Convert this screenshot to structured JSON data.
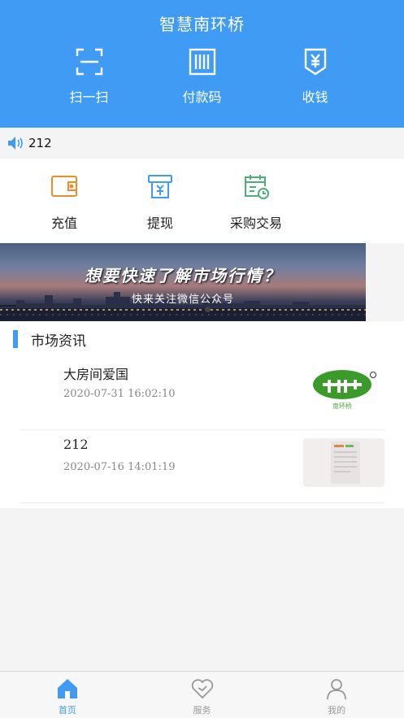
{
  "header": {
    "title": "智慧南环桥",
    "actions": [
      {
        "label": "扫一扫",
        "icon": "scan-icon"
      },
      {
        "label": "付款码",
        "icon": "barcode-icon"
      },
      {
        "label": "收钱",
        "icon": "receive-money-icon"
      }
    ]
  },
  "notice": {
    "text": "212",
    "icon": "speaker-icon"
  },
  "actions": [
    {
      "label": "充值",
      "icon": "wallet-icon",
      "color": "#f28c28"
    },
    {
      "label": "提现",
      "icon": "withdraw-icon",
      "color": "#3f9bf3"
    },
    {
      "label": "采购交易",
      "icon": "calendar-clock-icon",
      "color": "#4caf7a"
    }
  ],
  "banner": {
    "title": "想要快速了解市场行情？",
    "subtitle": "快来关注微信公众号"
  },
  "news": {
    "section_title": "市场资讯",
    "items": [
      {
        "title": "大房间爱国",
        "time": "2020-07-31 16:02:10",
        "thumb_text": "南环桥"
      },
      {
        "title": "212",
        "time": "2020-07-16 14:01:19"
      }
    ]
  },
  "tabbar": {
    "items": [
      {
        "label": "首页",
        "icon": "home-icon",
        "active": true
      },
      {
        "label": "服务",
        "icon": "heart-icon",
        "active": false
      },
      {
        "label": "我的",
        "icon": "user-icon",
        "active": false
      }
    ]
  },
  "colors": {
    "primary": "#3f9bf3",
    "orange": "#f28c28",
    "green": "#4caf7a"
  }
}
